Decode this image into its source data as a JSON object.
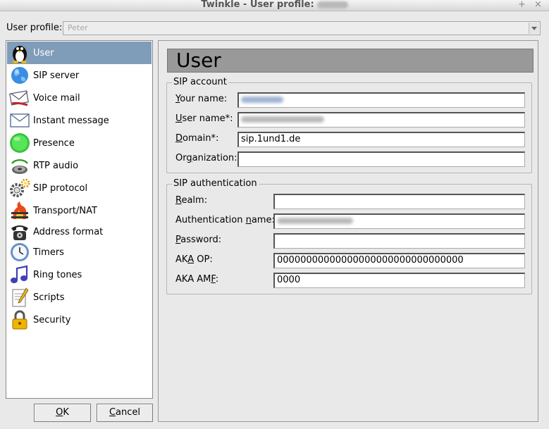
{
  "window": {
    "title": "Twinkle - User profile:"
  },
  "profile": {
    "label": "User profile:",
    "value": "Peter"
  },
  "sidebar": {
    "items": [
      {
        "label": "User",
        "icon": "penguin-icon",
        "selected": true
      },
      {
        "label": "SIP server",
        "icon": "globe-icon"
      },
      {
        "label": "Voice mail",
        "icon": "voicemail-envelope-icon"
      },
      {
        "label": "Instant message",
        "icon": "envelope-icon"
      },
      {
        "label": "Presence",
        "icon": "green-presence-icon"
      },
      {
        "label": "RTP audio",
        "icon": "speaker-icon"
      },
      {
        "label": "SIP protocol",
        "icon": "gears-icon"
      },
      {
        "label": "Transport/NAT",
        "icon": "firewall-icon"
      },
      {
        "label": "Address format",
        "icon": "telephone-icon"
      },
      {
        "label": "Timers",
        "icon": "clock-icon"
      },
      {
        "label": "Ring tones",
        "icon": "music-note-icon"
      },
      {
        "label": "Scripts",
        "icon": "script-icon"
      },
      {
        "label": "Security",
        "icon": "padlock-icon"
      }
    ]
  },
  "buttons": {
    "ok": {
      "mnemonic": "O",
      "rest": "K"
    },
    "cancel": {
      "mnemonic": "C",
      "rest": "ancel"
    }
  },
  "page": {
    "title": "User"
  },
  "sip_account": {
    "legend": "SIP account",
    "your_name": {
      "mnemonic": "Y",
      "rest": "our name:",
      "value": ""
    },
    "user_name": {
      "mnemonic": "U",
      "rest": "ser name*:",
      "value": ""
    },
    "domain": {
      "mnemonic": "D",
      "rest": "omain*:",
      "value": "sip.1und1.de"
    },
    "organization": {
      "pre": "Or",
      "mnemonic": "g",
      "rest": "anization:",
      "value": ""
    }
  },
  "sip_auth": {
    "legend": "SIP authentication",
    "realm": {
      "mnemonic": "R",
      "rest": "ealm:",
      "value": ""
    },
    "auth_name": {
      "pre": "Authentication ",
      "mnemonic": "n",
      "rest": "ame:",
      "value": ""
    },
    "password": {
      "mnemonic": "P",
      "rest": "assword:",
      "value": ""
    },
    "aka_op": {
      "pre": "AK",
      "mnemonic": "A",
      "rest": " OP:",
      "value": "00000000000000000000000000000000"
    },
    "aka_amf": {
      "pre": "AKA AM",
      "mnemonic": "F",
      "rest": ":",
      "value": "0000"
    }
  }
}
